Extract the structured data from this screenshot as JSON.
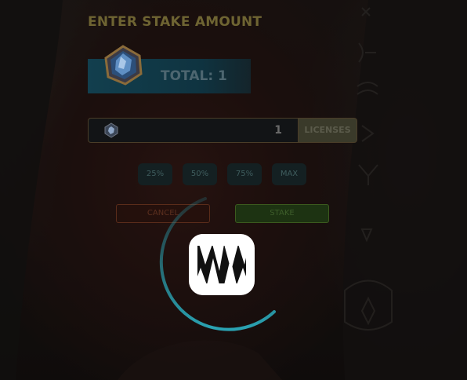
{
  "stake": {
    "title": "ENTER STAKE AMOUNT",
    "total_label": "TOTAL: 1",
    "input_value": "1",
    "unit_label": "LICENSES",
    "percent_buttons": [
      "25%",
      "50%",
      "75%",
      "MAX"
    ],
    "cancel_label": "CANCEL",
    "stake_label": "STAKE"
  },
  "loader": {
    "icon": "fangs-logo-icon",
    "state": "loading"
  },
  "colors": {
    "title": "#6e6432",
    "total_bar": "#123f4e",
    "stake_button": "#1d3312",
    "cancel_button_border": "#5a2c1a",
    "spinner": "#2aa3b3"
  }
}
